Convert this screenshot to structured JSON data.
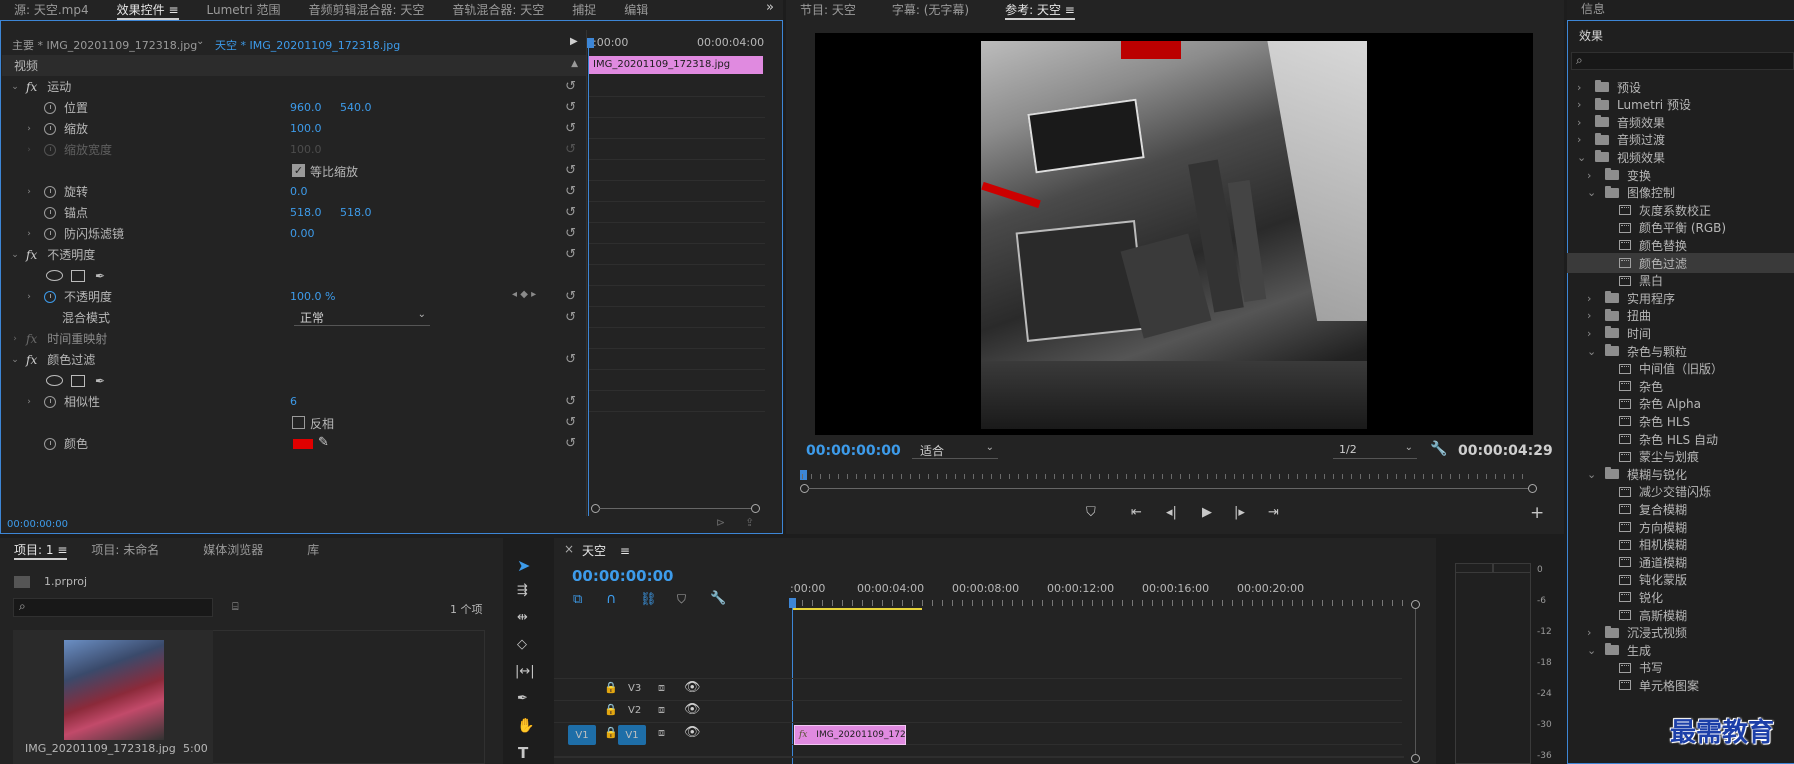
{
  "effect_controls": {
    "tabs": [
      "源: 天空.mp4",
      "效果控件",
      "Lumetri 范围",
      "音频剪辑混合器: 天空",
      "音轨混合器: 天空",
      "捕捉",
      "编辑"
    ],
    "active_tab_suffix": "≡",
    "master_label": "主要 * IMG_20201109_172318.jpg",
    "sequence_clip_label": "天空 * IMG_20201109_172318.jpg",
    "section_video": "视频",
    "motion": "运动",
    "position_label": "位置",
    "position_x": "960.0",
    "position_y": "540.0",
    "scale_label": "缩放",
    "scale_val": "100.0",
    "scale_width_label": "缩放宽度",
    "scale_width_val": "100.0",
    "uniform_scale": "等比缩放",
    "rotation_label": "旋转",
    "rotation_val": "0.0",
    "anchor_label": "锚点",
    "anchor_x": "518.0",
    "anchor_y": "518.0",
    "antiflicker_label": "防闪烁滤镜",
    "antiflicker_val": "0.00",
    "opacity_group": "不透明度",
    "opacity_label": "不透明度",
    "opacity_val": "100.0 %",
    "blend_label": "混合模式",
    "blend_val": "正常",
    "time_remap": "时间重映射",
    "color_pass": "颜色过滤",
    "similarity_label": "相似性",
    "similarity_val": "6",
    "invert_label": "反相",
    "color_label": "颜色",
    "color_swatch": "#e00000",
    "mini_tl_start": ":00:00",
    "mini_tl_end": "00:00:04:00",
    "mini_clip": "IMG_20201109_172318.jpg",
    "current_time": "00:00:00:00"
  },
  "program": {
    "tabs": [
      "节目: 天空",
      "字幕: (无字幕)",
      "参考: 天空"
    ],
    "active_tab_suffix": "≡",
    "timecode": "00:00:00:00",
    "fit": "适合",
    "resolution": "1/2",
    "duration": "00:00:04:29",
    "add_btn": "+"
  },
  "effects": {
    "title": "效果",
    "info_title": "信息",
    "items": [
      {
        "type": "folder",
        "level": 0,
        "arrow": "›",
        "label": "预设"
      },
      {
        "type": "folder",
        "level": 0,
        "arrow": "›",
        "label": "Lumetri 预设"
      },
      {
        "type": "folder",
        "level": 0,
        "arrow": "›",
        "label": "音频效果"
      },
      {
        "type": "folder",
        "level": 0,
        "arrow": "›",
        "label": "音频过渡"
      },
      {
        "type": "folder",
        "level": 0,
        "arrow": "⌄",
        "label": "视频效果"
      },
      {
        "type": "folder",
        "level": 1,
        "arrow": "›",
        "label": "变换"
      },
      {
        "type": "folder",
        "level": 1,
        "arrow": "⌄",
        "label": "图像控制"
      },
      {
        "type": "fx",
        "level": 2,
        "label": "灰度系数校正"
      },
      {
        "type": "fx",
        "level": 2,
        "label": "颜色平衡 (RGB)"
      },
      {
        "type": "fx",
        "level": 2,
        "label": "颜色替换"
      },
      {
        "type": "fx",
        "level": 2,
        "label": "颜色过滤",
        "selected": true
      },
      {
        "type": "fx",
        "level": 2,
        "label": "黑白"
      },
      {
        "type": "folder",
        "level": 1,
        "arrow": "›",
        "label": "实用程序"
      },
      {
        "type": "folder",
        "level": 1,
        "arrow": "›",
        "label": "扭曲"
      },
      {
        "type": "folder",
        "level": 1,
        "arrow": "›",
        "label": "时间"
      },
      {
        "type": "folder",
        "level": 1,
        "arrow": "⌄",
        "label": "杂色与颗粒"
      },
      {
        "type": "fx",
        "level": 2,
        "label": "中间值（旧版）"
      },
      {
        "type": "fx",
        "level": 2,
        "label": "杂色"
      },
      {
        "type": "fx",
        "level": 2,
        "label": "杂色 Alpha"
      },
      {
        "type": "fx",
        "level": 2,
        "label": "杂色 HLS"
      },
      {
        "type": "fx",
        "level": 2,
        "label": "杂色 HLS 自动"
      },
      {
        "type": "fx",
        "level": 2,
        "label": "蒙尘与划痕"
      },
      {
        "type": "folder",
        "level": 1,
        "arrow": "⌄",
        "label": "模糊与锐化"
      },
      {
        "type": "fx",
        "level": 2,
        "label": "减少交错闪烁"
      },
      {
        "type": "fx",
        "level": 2,
        "label": "复合模糊"
      },
      {
        "type": "fx",
        "level": 2,
        "label": "方向模糊"
      },
      {
        "type": "fx",
        "level": 2,
        "label": "相机模糊"
      },
      {
        "type": "fx",
        "level": 2,
        "label": "通道模糊"
      },
      {
        "type": "fx",
        "level": 2,
        "label": "钝化蒙版"
      },
      {
        "type": "fx",
        "level": 2,
        "label": "锐化"
      },
      {
        "type": "fx",
        "level": 2,
        "label": "高斯模糊"
      },
      {
        "type": "folder",
        "level": 1,
        "arrow": "›",
        "label": "沉浸式视频"
      },
      {
        "type": "folder",
        "level": 1,
        "arrow": "⌄",
        "label": "生成"
      },
      {
        "type": "fx",
        "level": 2,
        "label": "书写"
      },
      {
        "type": "fx",
        "level": 2,
        "label": "单元格图案"
      }
    ]
  },
  "project": {
    "tabs": [
      "项目: 1",
      "项目: 未命名",
      "媒体浏览器",
      "库"
    ],
    "active_tab_suffix": "≡",
    "file": "1.prproj",
    "count": "1 个项",
    "thumb_name": "IMG_20201109_172318.jpg",
    "thumb_dur": "5:00"
  },
  "timeline": {
    "close": "×",
    "title": "天空",
    "title_suffix": "≡",
    "timecode": "00:00:00:00",
    "ruler": [
      ":00:00",
      "00:00:04:00",
      "00:00:08:00",
      "00:00:12:00",
      "00:00:16:00",
      "00:00:20:00"
    ],
    "tracks": [
      "V3",
      "V2",
      "V1"
    ],
    "src_patch": "V1",
    "clip": "IMG_20201109_172318.jpg"
  },
  "audio_meter": {
    "scale": [
      "0",
      "-6",
      "-12",
      "-18",
      "-24",
      "-30",
      "-36"
    ]
  },
  "watermark": "最需教育"
}
